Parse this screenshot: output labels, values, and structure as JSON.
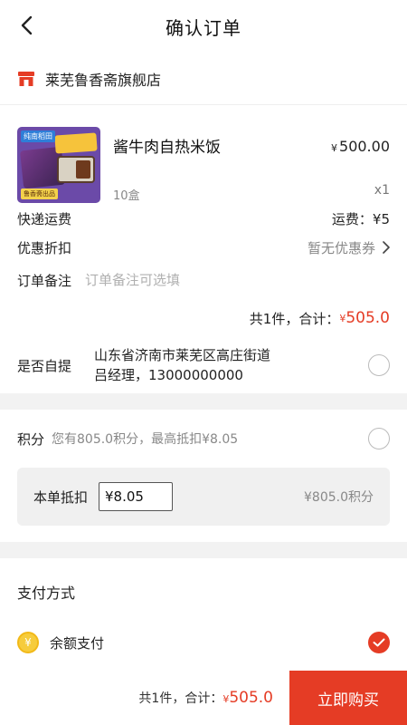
{
  "header": {
    "title": "确认订单"
  },
  "shop": {
    "name": "莱芜鲁香斋旗舰店"
  },
  "product": {
    "name": "酱牛肉自热米饭",
    "spec": "10盒",
    "price_symbol": "¥",
    "price": "500.00",
    "qty": "x1",
    "image_tag_top": "纯南稻田",
    "image_tag_bottom": "鲁香斋出品"
  },
  "shipping": {
    "label": "快递运费",
    "value": "运费：¥5"
  },
  "discount": {
    "label": "优惠折扣",
    "value": "暂无优惠券"
  },
  "remark": {
    "label": "订单备注",
    "placeholder": "订单备注可选填"
  },
  "subtotal": {
    "prefix": "共1件，合计：",
    "symbol": "¥",
    "amount": "505.0"
  },
  "pickup": {
    "label": "是否自提",
    "address_line1": "山东省济南市莱芜区高庄街道",
    "address_line2": "吕经理，13000000000"
  },
  "points": {
    "label": "积分",
    "desc": "您有805.0积分，最高抵扣¥8.05",
    "deduct_label": "本单抵扣",
    "deduct_value": "¥8.05",
    "deduct_points": "¥805.0积分"
  },
  "payment": {
    "title": "支付方式",
    "option_label": "余额支付",
    "coin_symbol": "¥"
  },
  "bottom": {
    "prefix": "共1件，合计：",
    "symbol": "¥",
    "amount": "505.0",
    "buy_label": "立即购买"
  },
  "colors": {
    "accent": "#e53c25",
    "coin": "#f6cc3c",
    "gap": "#f2f2f2"
  }
}
